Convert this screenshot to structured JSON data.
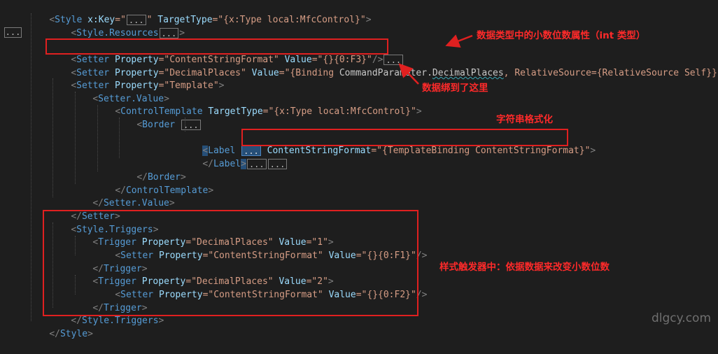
{
  "editor": {
    "gutter_fold": "...",
    "fold_marker": "...",
    "lines": {
      "l1": {
        "lt": "<",
        "tag": "Style",
        "a1": "x:Key",
        "eq1": "=\"",
        "q1": "\"",
        "a2": "TargetType",
        "v2": "=\"{x:Type local:MfcControl}\"",
        "gt": ">"
      },
      "l2": {
        "lt": "<",
        "tag": "Style.Resources",
        "gt": ">"
      },
      "l4": {
        "lt": "<",
        "tag": "Setter",
        "a1": "Property",
        "v1": "=\"ContentStringFormat\"",
        "a2": "Value",
        "v2": "=\"{}{0:F3}\"",
        "end": "/>"
      },
      "l5": {
        "lt": "<",
        "tag": "Setter",
        "a1": "Property",
        "v1": "=\"DecimalPlaces\"",
        "a2": "Value",
        "v2a": "=\"{Binding ",
        "v2b": "CommandParameter",
        "v2c": ".",
        "v2d": "DecimalPlaces",
        "v2e": ", RelativeSource={RelativeSource Self}}\"",
        "end": "/>"
      },
      "l6": {
        "lt": "<",
        "tag": "Setter",
        "a1": "Property",
        "v1": "=\"Template\"",
        "gt": ">"
      },
      "l7": {
        "lt": "<",
        "tag": "Setter.Value",
        "gt": ">"
      },
      "l8": {
        "lt": "<",
        "tag": "ControlTemplate",
        "a1": "TargetType",
        "v1": "=\"{x:Type local:MfcControl}\"",
        "gt": ">"
      },
      "l9": {
        "lt": "<",
        "tag": "Border"
      },
      "l11": {
        "lt": "<",
        "tag": "Label",
        "a1": "ContentStringFormat",
        "v1": "=\"{TemplateBinding ContentStringFormat}\"",
        "gt": ">"
      },
      "l12": {
        "lt": "</",
        "tag": "Label",
        "gt": ">"
      },
      "l13": {
        "lt": "</",
        "tag": "Border",
        "gt": ">"
      },
      "l14": {
        "lt": "</",
        "tag": "ControlTemplate",
        "gt": ">"
      },
      "l15": {
        "lt": "</",
        "tag": "Setter.Value",
        "gt": ">"
      },
      "l16": {
        "lt": "</",
        "tag": "Setter",
        "gt": ">"
      },
      "l17": {
        "lt": "<",
        "tag": "Style.Triggers",
        "gt": ">"
      },
      "l18": {
        "lt": "<",
        "tag": "Trigger",
        "a1": "Property",
        "v1": "=\"DecimalPlaces\"",
        "a2": "Value",
        "v2": "=\"1\"",
        "gt": ">"
      },
      "l19": {
        "lt": "<",
        "tag": "Setter",
        "a1": "Property",
        "v1": "=\"ContentStringFormat\"",
        "a2": "Value",
        "v2": "=\"{}{0:F1}\"",
        "end": "/>"
      },
      "l20": {
        "lt": "</",
        "tag": "Trigger",
        "gt": ">"
      },
      "l21": {
        "lt": "<",
        "tag": "Trigger",
        "a1": "Property",
        "v1": "=\"DecimalPlaces\"",
        "a2": "Value",
        "v2": "=\"2\"",
        "gt": ">"
      },
      "l22": {
        "lt": "<",
        "tag": "Setter",
        "a1": "Property",
        "v1": "=\"ContentStringFormat\"",
        "a2": "Value",
        "v2": "=\"{}{0:F2}\"",
        "end": "/>"
      },
      "l23": {
        "lt": "</",
        "tag": "Trigger",
        "gt": ">"
      },
      "l24": {
        "lt": "</",
        "tag": "Style.Triggers",
        "gt": ">"
      },
      "l25": {
        "lt": "</",
        "tag": "Style",
        "gt": ">"
      }
    }
  },
  "annotations": {
    "decimal_property": "数据类型中的小数位数属性（int 类型）",
    "bound_here": "数据绑到了这里",
    "string_format": "字符串格式化",
    "style_triggers": "样式触发器中：依据数据来改变小数位数"
  },
  "colors": {
    "background": "#1e1e1e",
    "tag": "#569cd6",
    "attribute": "#9cdcfe",
    "string": "#d69d85",
    "annotation_red": "#e02020"
  },
  "watermark": "dlgcy.com"
}
